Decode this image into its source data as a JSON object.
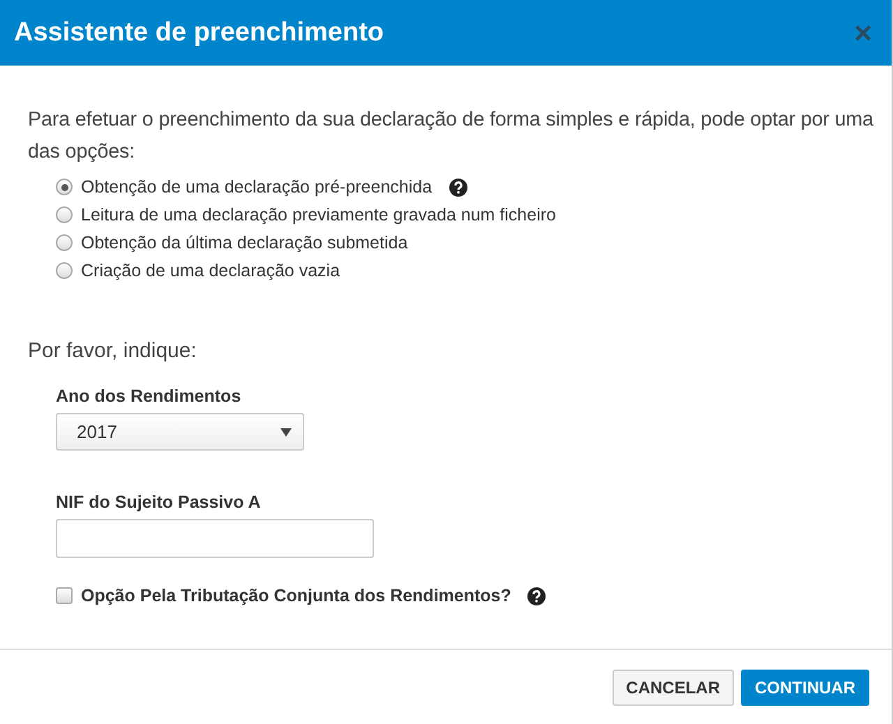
{
  "dialog": {
    "title": "Assistente de preenchimento",
    "close": "×"
  },
  "intro": "Para efetuar o preenchimento da sua declaração de forma simples e rápida, pode optar por uma das opções:",
  "options": [
    {
      "label": "Obtenção de uma declaração pré-preenchida",
      "selected": true,
      "help": true
    },
    {
      "label": "Leitura de uma declaração previamente gravada num ficheiro",
      "selected": false,
      "help": false
    },
    {
      "label": "Obtenção da última declaração submetida",
      "selected": false,
      "help": false
    },
    {
      "label": "Criação de uma declaração vazia",
      "selected": false,
      "help": false
    }
  ],
  "prompt": "Por favor, indique:",
  "year": {
    "label": "Ano dos Rendimentos",
    "value": "2017"
  },
  "nif": {
    "label": "NIF do Sujeito Passivo A"
  },
  "joint": {
    "label": "Opção Pela Tributação Conjunta dos Rendimentos?",
    "checked": false,
    "help": true
  },
  "buttons": [
    {
      "label": "CANCELAR",
      "kind": "secondary"
    },
    {
      "label": "CONTINUAR",
      "kind": "primary"
    }
  ]
}
